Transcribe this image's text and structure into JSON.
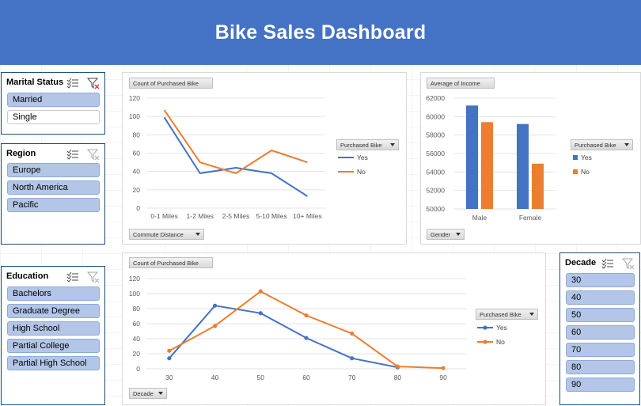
{
  "header": {
    "title": "Bike Sales Dashboard"
  },
  "colors": {
    "banner": "#4472c4",
    "yes": "#4472c4",
    "no": "#ed7d31",
    "slicer_selected": "#b4c6e7"
  },
  "slicers": {
    "marital_status": {
      "title": "Marital Status",
      "items": [
        {
          "label": "Married",
          "selected": true
        },
        {
          "label": "Single",
          "selected": false
        }
      ]
    },
    "region": {
      "title": "Region",
      "items": [
        {
          "label": "Europe",
          "selected": true
        },
        {
          "label": "North America",
          "selected": true
        },
        {
          "label": "Pacific",
          "selected": true
        }
      ]
    },
    "education": {
      "title": "Education",
      "items": [
        {
          "label": "Bachelors",
          "selected": true
        },
        {
          "label": "Graduate Degree",
          "selected": true
        },
        {
          "label": "High School",
          "selected": true
        },
        {
          "label": "Partial College",
          "selected": true
        },
        {
          "label": "Partial High School",
          "selected": true
        }
      ]
    },
    "decade": {
      "title": "Decade",
      "items": [
        {
          "label": "30",
          "selected": true
        },
        {
          "label": "40",
          "selected": true
        },
        {
          "label": "50",
          "selected": true
        },
        {
          "label": "60",
          "selected": true
        },
        {
          "label": "70",
          "selected": true
        },
        {
          "label": "80",
          "selected": true
        },
        {
          "label": "90",
          "selected": true
        }
      ]
    }
  },
  "icons": {
    "multiselect": "multiselect-icon",
    "clear_filter": "clear-filter-icon"
  },
  "charts": {
    "commute": {
      "value_button": "Count of Purchased Bike",
      "axis_button": "Commute Distance",
      "legend_button": "Purchased Bike"
    },
    "income": {
      "value_button": "Average of Income",
      "axis_button": "Gender",
      "legend_button": "Purchased Bike"
    },
    "decade": {
      "value_button": "Count of Purchased Bike",
      "axis_button": "Decade",
      "legend_button": "Purchased Bike"
    }
  },
  "chart_data": [
    {
      "type": "line",
      "categories": [
        "0-1 Miles",
        "1-2 Miles",
        "2-5 Miles",
        "5-10 Miles",
        "10+ Miles"
      ],
      "series": [
        {
          "name": "Yes",
          "values": [
            99,
            38,
            44,
            38,
            13
          ]
        },
        {
          "name": "No",
          "values": [
            107,
            50,
            38,
            63,
            50
          ]
        }
      ],
      "yticks": [
        0,
        20,
        40,
        60,
        80,
        100,
        120
      ],
      "ylim": [
        0,
        120
      ],
      "legend": "right",
      "markers": false
    },
    {
      "type": "bar",
      "categories": [
        "Male",
        "Female"
      ],
      "series": [
        {
          "name": "Yes",
          "values": [
            61200,
            59200
          ]
        },
        {
          "name": "No",
          "values": [
            59400,
            54900
          ]
        }
      ],
      "yticks": [
        50000,
        52000,
        54000,
        56000,
        58000,
        60000,
        62000
      ],
      "ylim": [
        50000,
        62000
      ],
      "legend": "right"
    },
    {
      "type": "line",
      "categories": [
        "30",
        "40",
        "50",
        "60",
        "70",
        "80",
        "90"
      ],
      "series": [
        {
          "name": "Yes",
          "values": [
            14,
            84,
            74,
            41,
            14,
            2,
            null
          ]
        },
        {
          "name": "No",
          "values": [
            24,
            57,
            103,
            71,
            47,
            3,
            1
          ]
        }
      ],
      "yticks": [
        0,
        20,
        40,
        60,
        80,
        100,
        120
      ],
      "ylim": [
        0,
        120
      ],
      "legend": "right",
      "markers": true
    }
  ]
}
